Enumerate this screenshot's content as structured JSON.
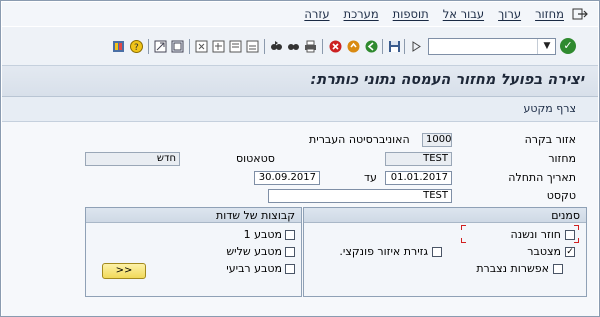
{
  "menu": {
    "items": [
      "מחזור",
      "ערוך",
      "עבור אל",
      "תוספות",
      "מערכת",
      "עזרה"
    ]
  },
  "toolbar": {
    "icons": [
      "green-check-icon",
      "save-icon",
      "back-icon",
      "exit-icon",
      "cancel-icon",
      "print-icon",
      "find-icon",
      "find-next-icon",
      "first-page-icon",
      "prev-page-icon",
      "next-page-icon",
      "last-page-icon",
      "create-session-icon",
      "shortcut-icon",
      "help-icon",
      "layout-icon"
    ]
  },
  "title": "יצירה בפועל מחזור העמסה נתוני כותרת:",
  "apptool": {
    "attach_segment": "צרף מקטע"
  },
  "form": {
    "area_label": "אזור בקרה",
    "area_value": "1000",
    "area_desc": "האוניברסיטה העברית",
    "cycle_label": "מחזור",
    "cycle_value": "TEST",
    "status_label": "סטאטוס",
    "status_value": "חדש",
    "start_label": "תאריך התחלה",
    "start_value": "01.01.2017",
    "to_label": "עד",
    "end_value": "30.09.2017",
    "text_label": "טקסט",
    "text_value": "TEST"
  },
  "flags": {
    "title": "סמנים",
    "repeat": "חוזר ונשנה",
    "cumulative": "מצטבר",
    "func_area": "גזירת איזור פונקצי.",
    "accumulate": "אפשרות נצברת"
  },
  "fieldgroups": {
    "title": "קבוצות של שדות",
    "c1": "מטבע 1",
    "c3": "מטבע שליש",
    "c4": "מטבע רביעי",
    "more_btn": ">>"
  },
  "colors": {
    "accent": "#2f8a2f",
    "title_text": "#1d2738"
  }
}
